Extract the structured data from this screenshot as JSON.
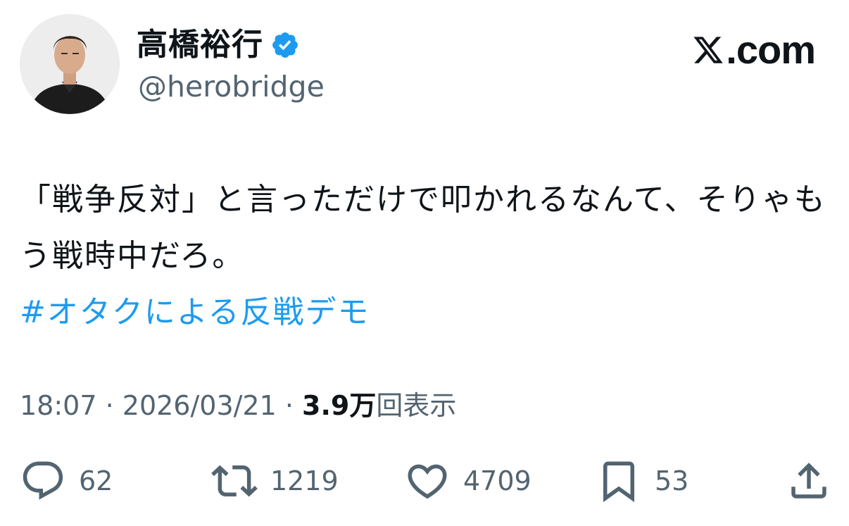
{
  "author": {
    "display_name": "高橋裕行",
    "handle": "@herobridge",
    "verified": true
  },
  "brand": {
    "label": "𝕏.com",
    "text": ".com"
  },
  "tweet": {
    "text": "「戦争反対」と言っただけで叩かれるなんて、そりゃもう戦時中だろ。",
    "hashtag": "#オタクによる反戦デモ"
  },
  "meta": {
    "time": "18:07",
    "separator": " · ",
    "date": "2026/03/21",
    "views_count": "3.9万",
    "views_label": "回表示"
  },
  "actions": {
    "replies": "62",
    "retweets": "1219",
    "likes": "4709",
    "bookmarks": "53"
  },
  "colors": {
    "accent": "#1d9bf0",
    "text": "#0f1419",
    "secondary": "#536471"
  },
  "icons": {
    "verified": "verified-badge-icon",
    "brand": "x-logo-icon",
    "reply": "reply-icon",
    "retweet": "retweet-icon",
    "like": "heart-icon",
    "bookmark": "bookmark-icon",
    "share": "share-icon"
  }
}
